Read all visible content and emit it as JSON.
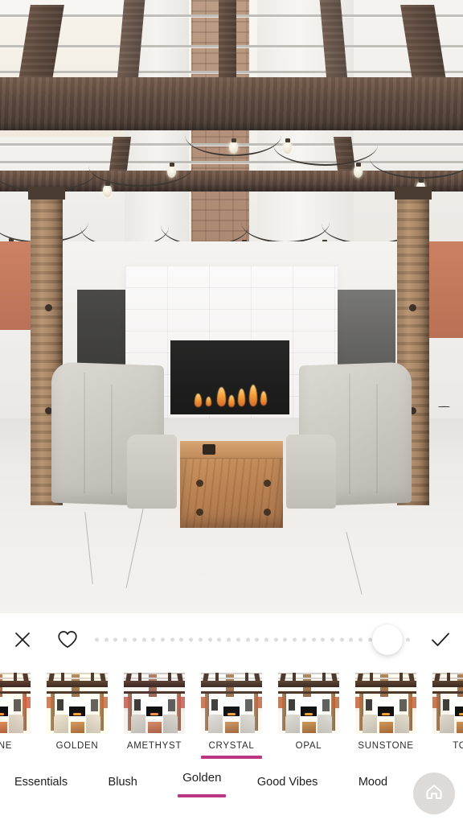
{
  "app": {
    "screen_name": "photo-filter-editor",
    "accent_color": "#bb3683",
    "background": "#ffffff"
  },
  "photo": {
    "alt": "Outdoor patio with wooden pergola, string lights, white brick fireplace with fire, two slipcovered armchairs and a rustic wood block coffee table on concrete",
    "applied_filter": "CRYSTAL"
  },
  "toolbar": {
    "cancel_icon": "close-icon",
    "favorite_icon": "heart-icon",
    "confirm_icon": "check-icon",
    "slider": {
      "name": "filter-strength-slider",
      "dot_count": 34,
      "value_percent": 100,
      "knob_position_percent": 92,
      "dot_color": "#dcdcdc",
      "knob_color": "#ffffff"
    }
  },
  "filters": {
    "selected": "CRYSTAL",
    "items": [
      {
        "label": "RINE",
        "full_label": "RINE",
        "active": false,
        "grade": "nectarine"
      },
      {
        "label": "GOLDEN",
        "full_label": "GOLDEN",
        "active": false,
        "grade": "golden"
      },
      {
        "label": "AMETHYST",
        "full_label": "AMETHYST",
        "active": false,
        "grade": "amethyst"
      },
      {
        "label": "CRYSTAL",
        "full_label": "CRYSTAL",
        "active": true,
        "grade": "crystal"
      },
      {
        "label": "OPAL",
        "full_label": "OPAL",
        "active": false,
        "grade": "opal"
      },
      {
        "label": "SUNSTONE",
        "full_label": "SUNSTONE",
        "active": false,
        "grade": "sunstone"
      },
      {
        "label": "TOP",
        "full_label": "TOP",
        "active": false,
        "grade": "topaz"
      }
    ]
  },
  "categories": {
    "selected": "Golden",
    "items": [
      {
        "label": "Essentials",
        "active": false
      },
      {
        "label": "Blush",
        "active": false
      },
      {
        "label": "Golden",
        "active": true
      },
      {
        "label": "Good Vibes",
        "active": false
      },
      {
        "label": "Mood",
        "active": false
      }
    ],
    "home_button": {
      "icon": "home-icon",
      "background": "#dcdbd9"
    }
  }
}
